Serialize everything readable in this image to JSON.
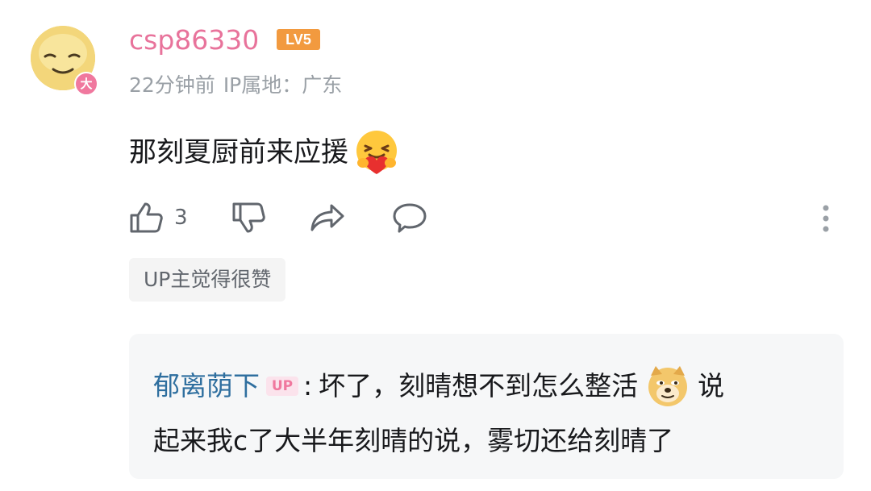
{
  "comment": {
    "username": "csp86330",
    "level": "LV5",
    "avatar_badge": "大",
    "time": "22分钟前",
    "ip_location": "IP属地：广东",
    "text": "那刻夏厨前来应援",
    "emoji": "hug-heart-emoji",
    "likes": "3",
    "tag": "UP主觉得很赞",
    "colors": {
      "username": "#e8739b",
      "level": "#f29a3f",
      "meta": "#9aa0a6",
      "reply_author": "#2f6f9f"
    }
  },
  "reply": {
    "author": "郁离荫下",
    "author_badge": "UP",
    "separator": ":",
    "text_part1": "坏了，刻晴想不到怎么整活",
    "emoji": "doge-emoji",
    "text_part2": "说",
    "text_line2": "起来我c了大半年刻晴的说，雾切还给刻晴了"
  },
  "icons": [
    "thumb-up-icon",
    "thumb-down-icon",
    "share-icon",
    "comment-icon",
    "more-vertical-icon"
  ]
}
